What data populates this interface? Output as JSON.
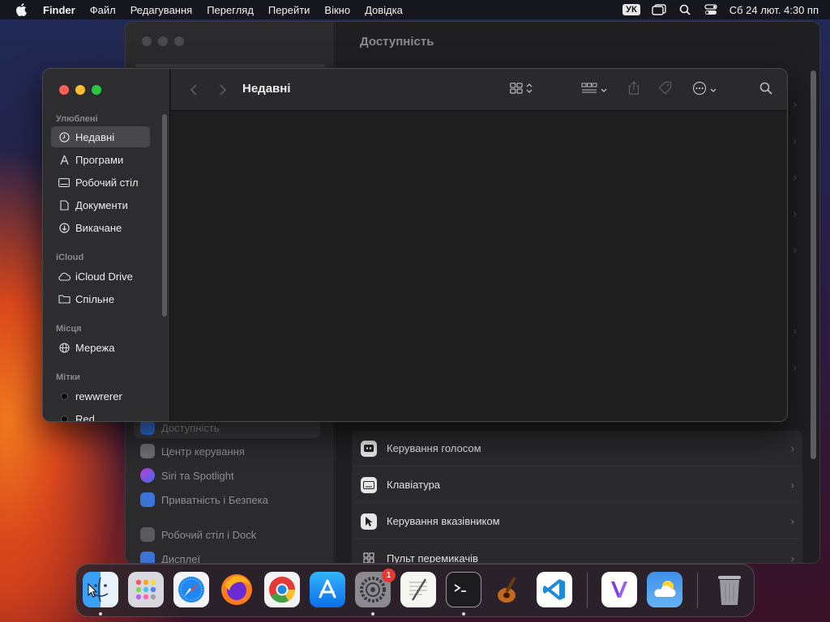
{
  "menubar": {
    "app": "Finder",
    "items": [
      "Файл",
      "Редагування",
      "Перегляд",
      "Перейти",
      "Вікно",
      "Довідка"
    ],
    "input_source": "УК",
    "datetime": "Сб 24 лют. 4:30 пп"
  },
  "settings_window": {
    "title": "Доступність",
    "sidebar": [
      "Доступність",
      "Центр керування",
      "Siri та Spotlight",
      "Приватність і Безпека",
      "Робочий стіл і Dock",
      "Дисплеї"
    ],
    "rows": [
      "Керування голосом",
      "Клавіатура",
      "Керування вказівником",
      "Пульт перемикачів"
    ]
  },
  "finder": {
    "title": "Недавні",
    "sections": {
      "favorites": "Улюблені",
      "icloud": "iCloud",
      "locations": "Місця",
      "tags": "Мітки"
    },
    "favorites": [
      "Недавні",
      "Програми",
      "Робочий стіл",
      "Документи",
      "Викачане"
    ],
    "icloud": [
      "iCloud Drive",
      "Спільне"
    ],
    "locations": [
      "Мережа"
    ],
    "tags": [
      "rewwrerer",
      "Red"
    ]
  },
  "dock": {
    "apps": [
      "Finder",
      "Launchpad",
      "Safari",
      "Firefox",
      "Chrome",
      "App Store",
      "System Settings",
      "TextEdit",
      "Terminal",
      "GarageBand",
      "VS Code",
      "Visual Studio",
      "Weather",
      "Trash"
    ],
    "settings_badge": "1"
  },
  "colors": {
    "close": "#ff5f57",
    "minimize": "#febc2e",
    "zoom": "#28c840",
    "badge": "#e53935"
  }
}
